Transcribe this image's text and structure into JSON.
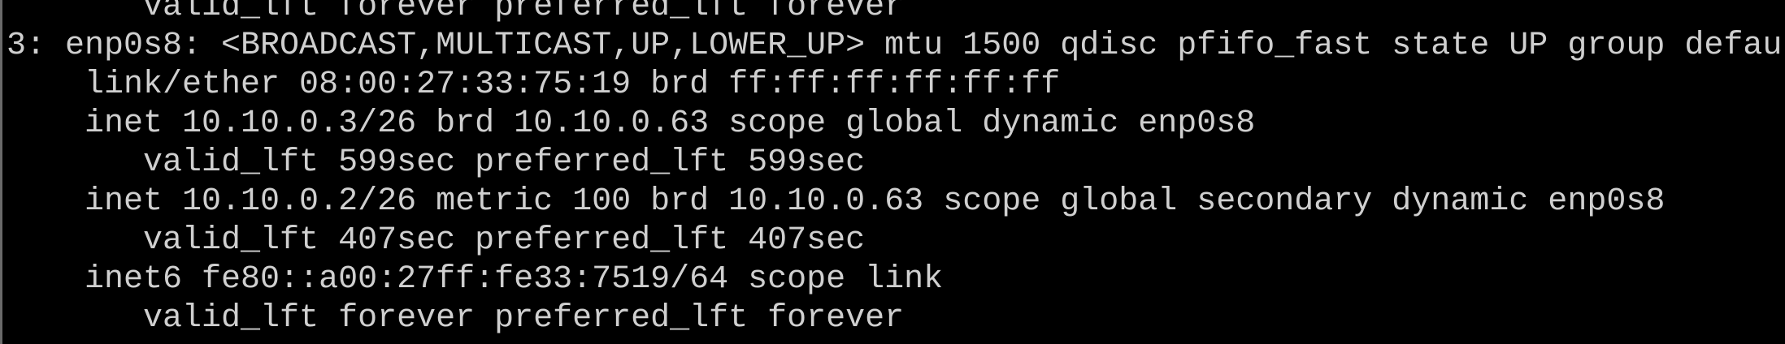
{
  "terminal": {
    "lines": [
      "       valid_lft forever preferred_lft forever",
      "3: enp0s8: <BROADCAST,MULTICAST,UP,LOWER_UP> mtu 1500 qdisc pfifo_fast state UP group defau",
      "    link/ether 08:00:27:33:75:19 brd ff:ff:ff:ff:ff:ff",
      "    inet 10.10.0.3/26 brd 10.10.0.63 scope global dynamic enp0s8",
      "       valid_lft 599sec preferred_lft 599sec",
      "    inet 10.10.0.2/26 metric 100 brd 10.10.0.63 scope global secondary dynamic enp0s8",
      "       valid_lft 407sec preferred_lft 407sec",
      "    inet6 fe80::a00:27ff:fe33:7519/64 scope link",
      "       valid_lft forever preferred_lft forever"
    ]
  }
}
